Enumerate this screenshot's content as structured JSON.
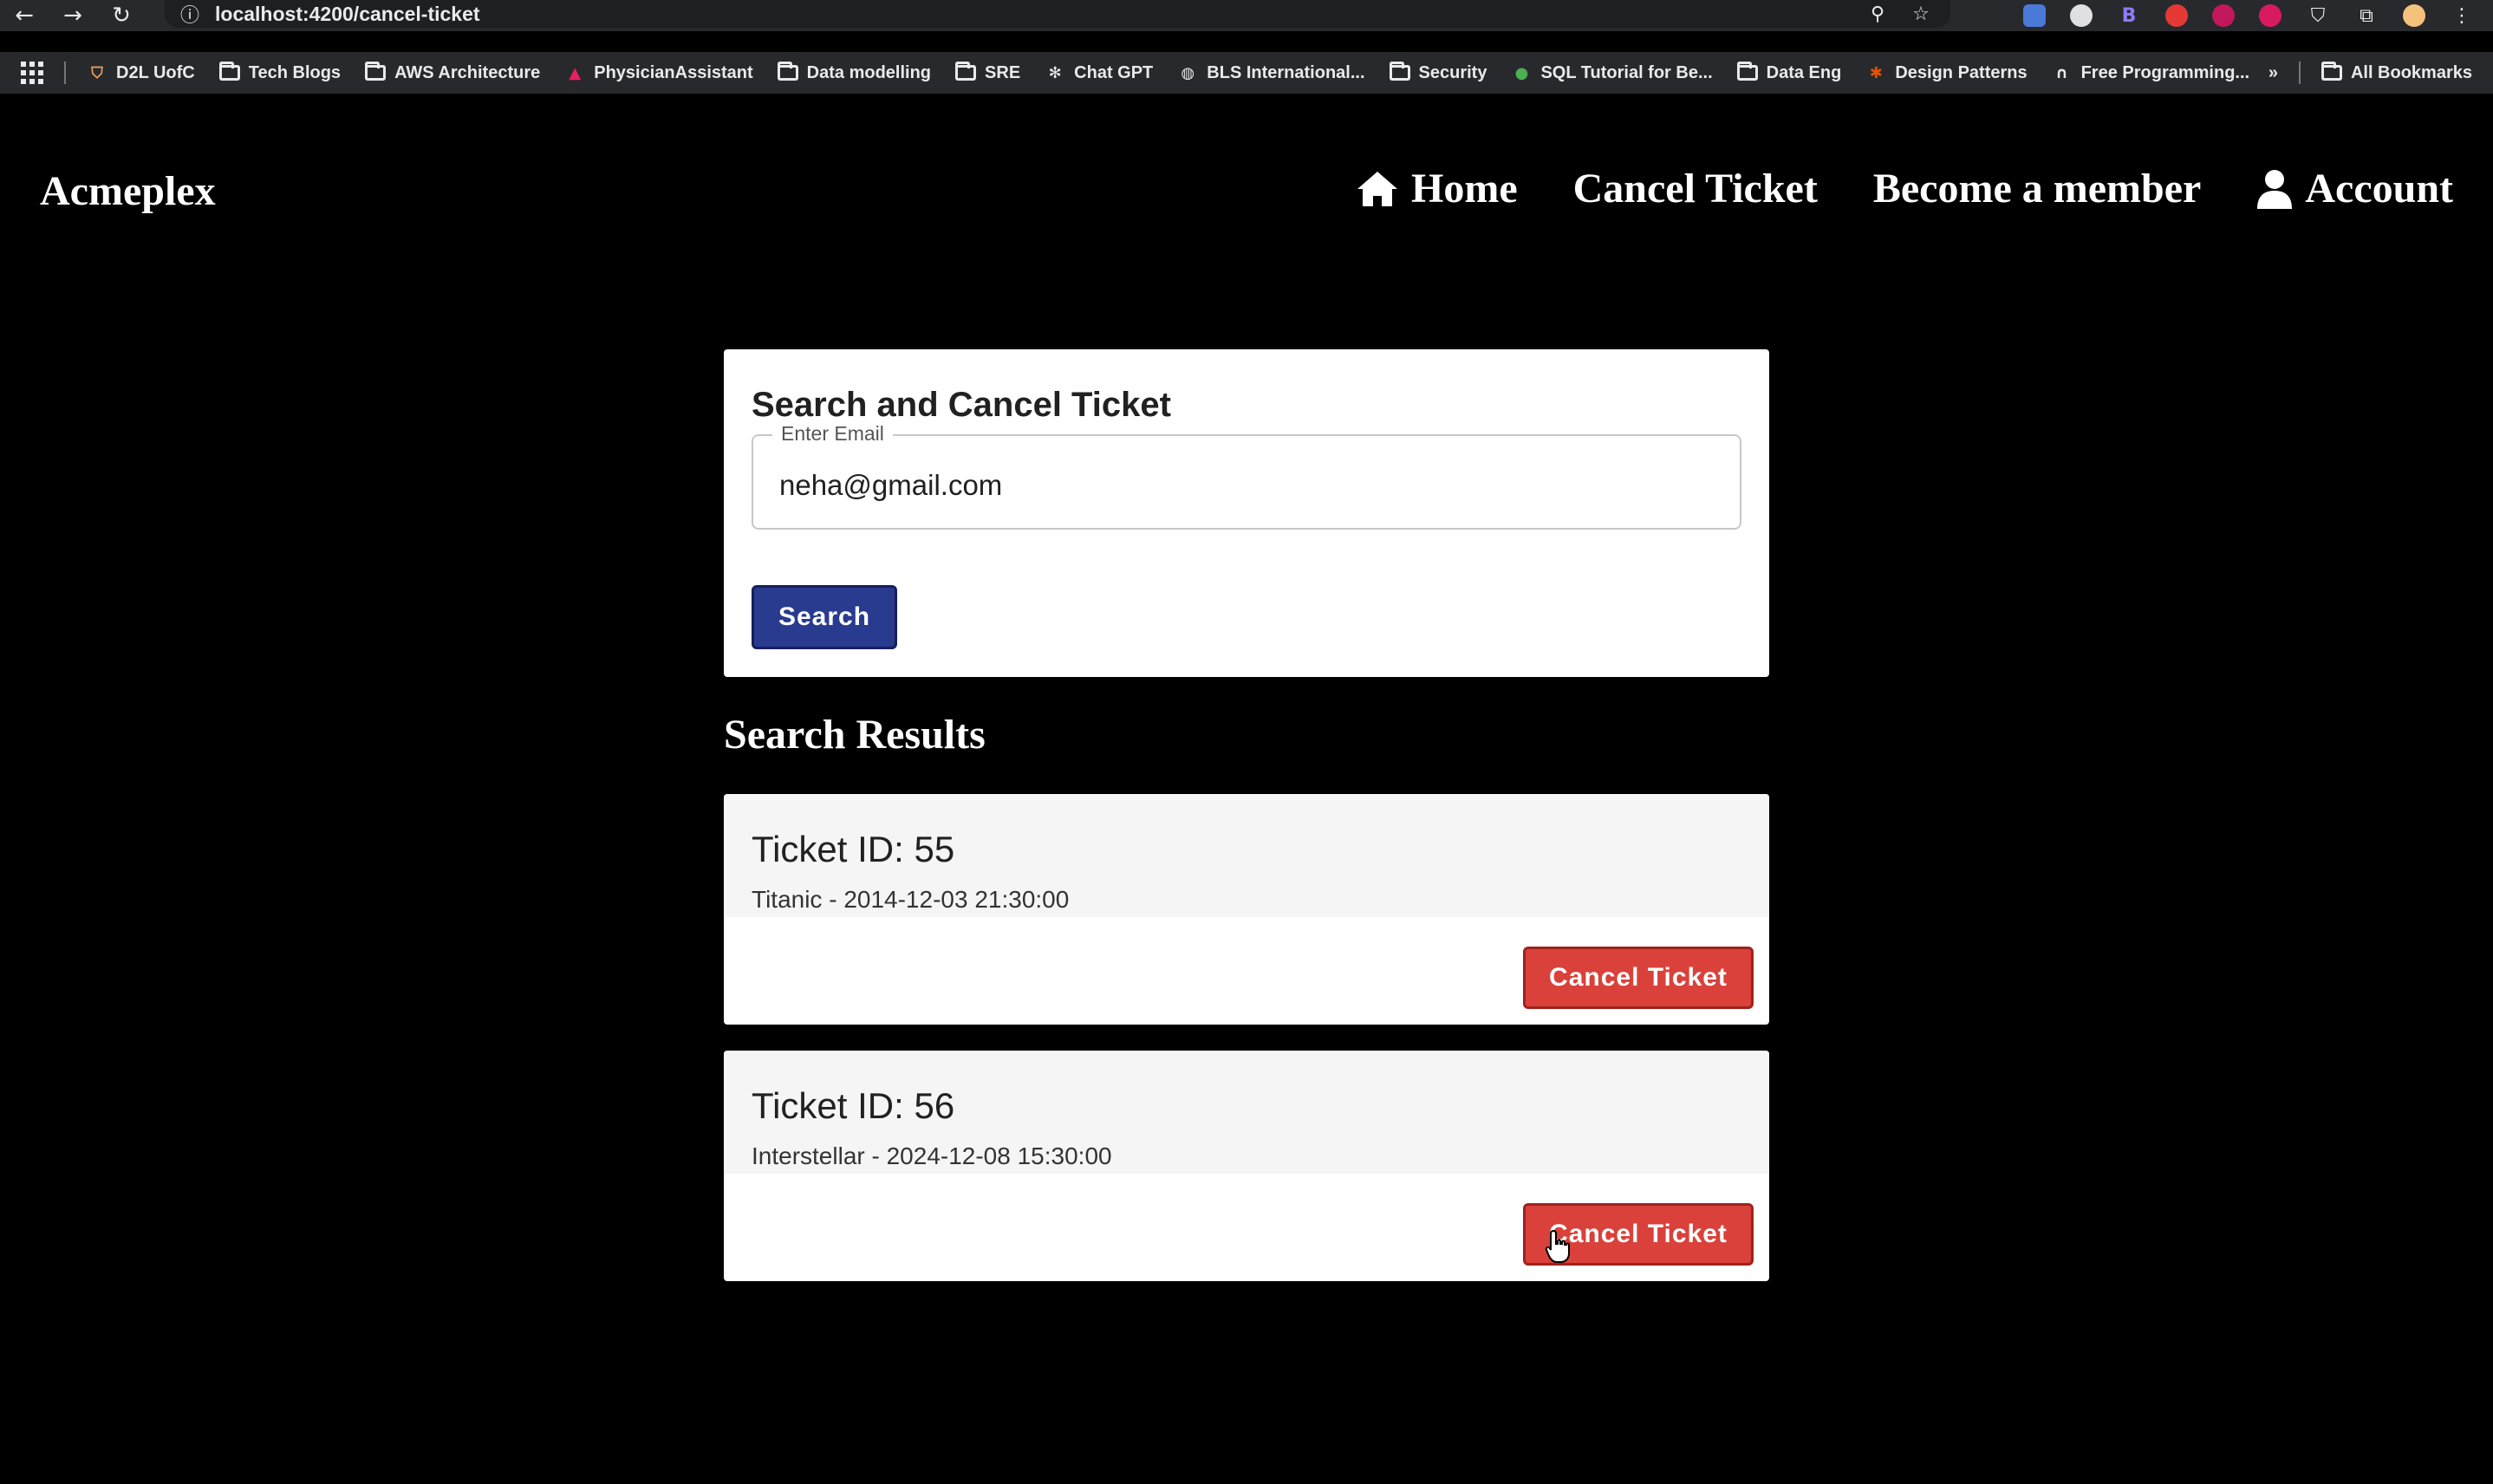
{
  "browser": {
    "url": "localhost:4200/cancel-ticket",
    "bookmarks": [
      {
        "label": "D2L UofC",
        "icon": "shield-icon"
      },
      {
        "label": "Tech Blogs",
        "icon": "folder-icon"
      },
      {
        "label": "AWS Architecture",
        "icon": "folder-icon"
      },
      {
        "label": "PhysicianAssistant",
        "icon": "angular-icon"
      },
      {
        "label": "Data modelling",
        "icon": "folder-icon"
      },
      {
        "label": "SRE",
        "icon": "folder-icon"
      },
      {
        "label": "Chat GPT",
        "icon": "openai-icon"
      },
      {
        "label": "BLS International...",
        "icon": "globe-icon"
      },
      {
        "label": "Security",
        "icon": "folder-icon"
      },
      {
        "label": "SQL Tutorial for Be...",
        "icon": "dot-icon"
      },
      {
        "label": "Data Eng",
        "icon": "folder-icon"
      },
      {
        "label": "Design Patterns",
        "icon": "refactoring-icon"
      },
      {
        "label": "Free Programming...",
        "icon": "headphones-icon"
      }
    ],
    "all_bookmarks": "All Bookmarks",
    "overflow": "»"
  },
  "header": {
    "brand": "Acmeplex",
    "nav": {
      "home": "Home",
      "cancel": "Cancel Ticket",
      "member": "Become a member",
      "account": "Account"
    }
  },
  "search": {
    "title": "Search and Cancel Ticket",
    "email_label": "Enter Email",
    "email_value": "neha@gmail.com",
    "button": "Search"
  },
  "results": {
    "title": "Search Results",
    "tickets": [
      {
        "id_label": "Ticket ID: 55",
        "details": "Titanic - 2014-12-03 21:30:00",
        "button": "Cancel Ticket"
      },
      {
        "id_label": "Ticket ID: 56",
        "details": "Interstellar - 2024-12-08 15:30:00",
        "button": "Cancel Ticket"
      }
    ]
  },
  "colors": {
    "search_button": "#293b8f",
    "cancel_button": "#d9413a",
    "background": "#000000"
  }
}
